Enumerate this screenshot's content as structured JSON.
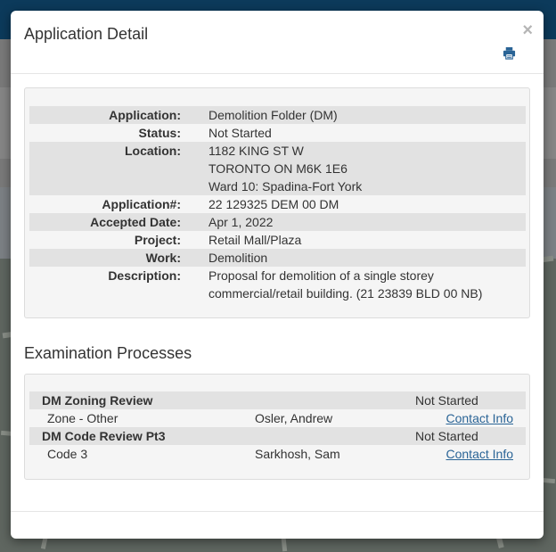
{
  "modal": {
    "title": "Application Detail",
    "close_label": "×",
    "print_icon": "print-icon"
  },
  "application": {
    "rows": [
      {
        "label": "Application:",
        "lines": [
          "Demolition Folder (DM)"
        ]
      },
      {
        "label": "Status:",
        "lines": [
          "Not Started"
        ]
      },
      {
        "label": "Location:",
        "lines": [
          "1182 KING ST W",
          "TORONTO ON M6K 1E6",
          "Ward 10: Spadina-Fort York"
        ]
      },
      {
        "label": "Application#:",
        "lines": [
          "22 129325 DEM 00 DM"
        ]
      },
      {
        "label": "Accepted Date:",
        "lines": [
          "Apr 1, 2022"
        ]
      },
      {
        "label": "Project:",
        "lines": [
          "Retail Mall/Plaza"
        ]
      },
      {
        "label": "Work:",
        "lines": [
          "Demolition"
        ]
      },
      {
        "label": "Description:",
        "lines": [
          "Proposal for demolition of a single storey",
          "commercial/retail building. (21 23839 BLD 00 NB)"
        ]
      }
    ]
  },
  "examination": {
    "heading": "Examination Processes",
    "processes": [
      {
        "name": "DM Zoning Review",
        "status": "Not Started",
        "sub": {
          "name": "Zone - Other",
          "reviewer": "Osler, Andrew",
          "link": "Contact Info"
        }
      },
      {
        "name": "DM Code Review Pt3",
        "status": "Not Started",
        "sub": {
          "name": "Code 3",
          "reviewer": "Sarkhosh, Sam",
          "link": "Contact Info"
        }
      }
    ]
  },
  "colors": {
    "accent_link": "#2a6496",
    "shade_row": "#e2e2e2",
    "panel_bg": "#f5f5f5",
    "topbar": "#0c3a5b"
  }
}
